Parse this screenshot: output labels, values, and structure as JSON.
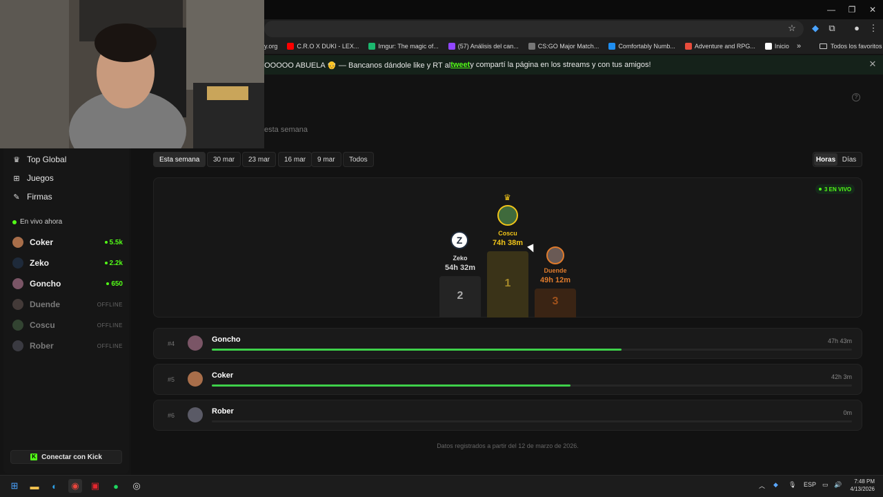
{
  "banner": {
    "text_before": "🔥 APOYOOOOO ABUELA 👴 — Bancanos dándole like y RT al ",
    "link": "tweet",
    "text_after": " y compartí la página en los streams y con tus amigos!"
  },
  "bookmarks": [
    {
      "label": "y.org",
      "color": "#888"
    },
    {
      "label": "C.R.O X DUKI - LEX...",
      "color": "#ff0000"
    },
    {
      "label": "Imgur: The magic of...",
      "color": "#1bb76e"
    },
    {
      "label": "(57) Análisis del can...",
      "color": "#9146ff"
    },
    {
      "label": "CS:GO Major Match...",
      "color": "#777"
    },
    {
      "label": "Comfortably Numb...",
      "color": "#1f8ef1"
    },
    {
      "label": "Adventure and RPG...",
      "color": "#e74c3c"
    },
    {
      "label": "Inicio",
      "color": "#ffffff"
    }
  ],
  "bookmarks_all": "Todos los favoritos",
  "subtitle": "esta semana",
  "nav": [
    {
      "label": "Top Global",
      "icon": "crown-icon"
    },
    {
      "label": "Juegos",
      "icon": "gamepad-icon"
    },
    {
      "label": "Firmas",
      "icon": "pen-icon"
    }
  ],
  "live_now_label": "En vivo ahora",
  "streamers": [
    {
      "name": "Coker",
      "count": "5.5k",
      "live": true,
      "color": "#a86e4a"
    },
    {
      "name": "Zeko",
      "count": "2.2k",
      "live": true,
      "color": "#1e2a3a"
    },
    {
      "name": "Goncho",
      "count": "650",
      "live": true,
      "color": "#7a5566"
    },
    {
      "name": "Duende",
      "count": "OFFLINE",
      "live": false,
      "color": "#6a5a55"
    },
    {
      "name": "Coscu",
      "count": "OFFLINE",
      "live": false,
      "color": "#4a6a48"
    },
    {
      "name": "Rober",
      "count": "OFFLINE",
      "live": false,
      "color": "#5a5a66"
    }
  ],
  "kick_button": "Conectar con Kick",
  "week_chips": [
    "Esta semana",
    "30 mar",
    "23 mar",
    "16 mar",
    "9 mar",
    "Todos"
  ],
  "unit_toggle": [
    "Horas",
    "Días"
  ],
  "live_badge": "3 EN VIVO",
  "podium": {
    "first": {
      "name": "Coscu",
      "time": "74h 38m",
      "place": "1"
    },
    "second": {
      "name": "Zeko",
      "time": "54h 32m",
      "place": "2"
    },
    "third": {
      "name": "Duende",
      "time": "49h 12m",
      "place": "3"
    }
  },
  "rows": [
    {
      "rank": "#4",
      "name": "Goncho",
      "time": "47h 43m",
      "progress": 0.64,
      "color": "#7a5566"
    },
    {
      "rank": "#5",
      "name": "Coker",
      "time": "42h 3m",
      "progress": 0.56,
      "color": "#a86e4a"
    },
    {
      "rank": "#6",
      "name": "Rober",
      "time": "0m",
      "progress": 0,
      "color": "#5a5a66"
    }
  ],
  "footer_note": "Datos registrados a partir del 12 de marzo de 2026.",
  "taskbar": {
    "lang": "ESP",
    "time": "7:48 PM",
    "date": "4/13/2026"
  },
  "colors": {
    "accent": "#53fc18",
    "gold": "#f0c419",
    "silver": "#d6d6d6",
    "bronze": "#e07b2c"
  }
}
